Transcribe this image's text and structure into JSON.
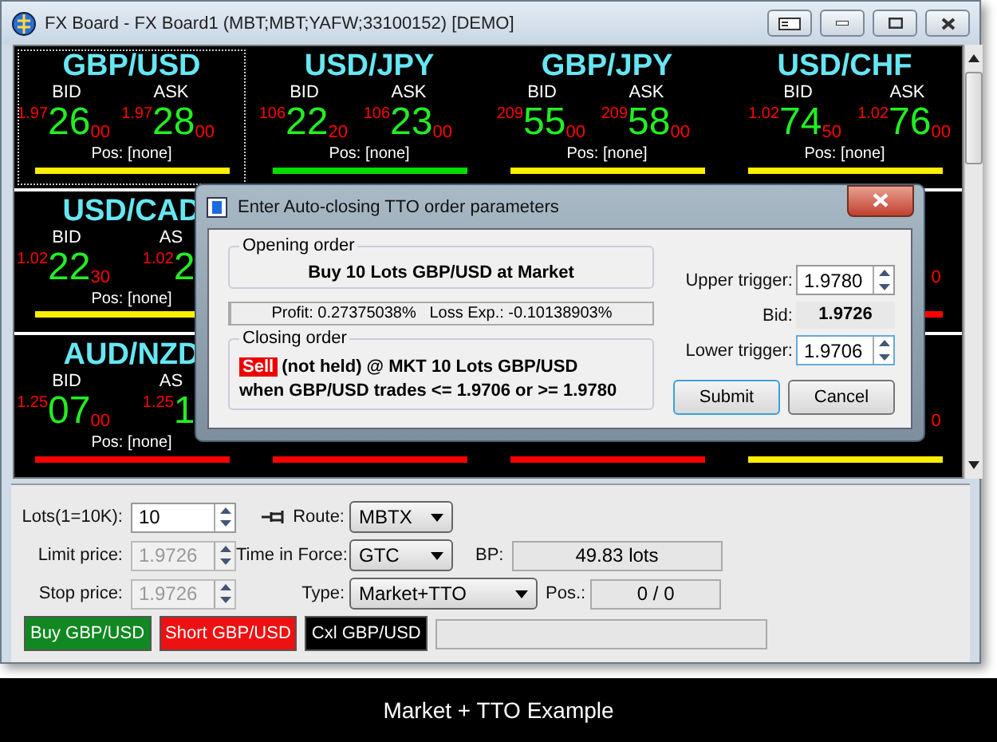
{
  "window": {
    "title": "FX Board - FX Board1 (MBT;MBT;YAFW;33100152) [DEMO]"
  },
  "board": {
    "rows": [
      {
        "tiles": [
          {
            "pair": "GBP/USD",
            "selected": true,
            "bid": {
              "label": "BID",
              "prefix": "1.97",
              "big": "26",
              "small": "00"
            },
            "ask": {
              "label": "ASK",
              "prefix": "1.97",
              "big": "28",
              "small": "00"
            },
            "pos": "Pos: [none]",
            "color": "#ffee00"
          },
          {
            "pair": "USD/JPY",
            "selected": false,
            "bid": {
              "label": "BID",
              "prefix": "106",
              "big": "22",
              "small": "20"
            },
            "ask": {
              "label": "ASK",
              "prefix": "106",
              "big": "23",
              "small": "00"
            },
            "pos": "Pos: [none]",
            "color": "#00dd00"
          },
          {
            "pair": "GBP/JPY",
            "selected": false,
            "bid": {
              "label": "BID",
              "prefix": "209",
              "big": "55",
              "small": "00"
            },
            "ask": {
              "label": "ASK",
              "prefix": "209",
              "big": "58",
              "small": "00"
            },
            "pos": "Pos: [none]",
            "color": "#ffee00"
          },
          {
            "pair": "USD/CHF",
            "selected": false,
            "bid": {
              "label": "BID",
              "prefix": "1.02",
              "big": "74",
              "small": "50"
            },
            "ask": {
              "label": "ASK",
              "prefix": "1.02",
              "big": "76",
              "small": "00"
            },
            "pos": "Pos: [none]",
            "color": "#ffee00"
          }
        ]
      },
      {
        "tiles": [
          {
            "pair": "USD/CAD",
            "selected": false,
            "bid": {
              "label": "BID",
              "prefix": "1.02",
              "big": "22",
              "small": "30"
            },
            "ask": {
              "label": "AS",
              "prefix": "1.02",
              "big": "2"
            },
            "pos": "Pos: [none]",
            "color": "#ffee00"
          },
          {
            "selected": false,
            "ask": {
              "small": "0"
            },
            "color": "#ff0000"
          }
        ]
      },
      {
        "tiles": [
          {
            "pair": "AUD/NZD",
            "selected": false,
            "bid": {
              "label": "BID",
              "prefix": "1.25",
              "big": "07",
              "small": "00"
            },
            "ask": {
              "label": "AS",
              "prefix": "1.25",
              "big": "1"
            },
            "pos": "Pos: [none]",
            "color": "#ff0000"
          },
          {
            "selected": false,
            "color": "#ff0000"
          },
          {
            "selected": false,
            "color": "#ff0000"
          },
          {
            "selected": false,
            "ask": {
              "small": "0"
            },
            "color": "#ffee00"
          }
        ]
      }
    ]
  },
  "order_panel": {
    "lots": {
      "label": "Lots(1=10K):",
      "value": "10",
      "disabled": false
    },
    "limit": {
      "label": "Limit price:",
      "value": "1.9726",
      "disabled": true
    },
    "stop": {
      "label": "Stop price:",
      "value": "1.9726",
      "disabled": true
    },
    "route": {
      "label": "Route:",
      "value": "MBTX"
    },
    "tif": {
      "label": "Time in Force:",
      "value": "GTC"
    },
    "type": {
      "label": "Type:",
      "value": "Market+TTO"
    },
    "bp": {
      "label": "BP:",
      "value": "49.83 lots"
    },
    "pos": {
      "label": "Pos.:",
      "value": "0 / 0"
    },
    "buttons": [
      {
        "label": "Buy GBP/USD",
        "kind": "buy"
      },
      {
        "label": "Short GBP/USD",
        "kind": "short"
      },
      {
        "label": "Cxl GBP/USD",
        "kind": "cancel"
      }
    ]
  },
  "dialog": {
    "title": "Enter Auto-closing TTO order parameters",
    "opening_order": {
      "legend": "Opening order",
      "text": "Buy 10 Lots GBP/USD at Market"
    },
    "stats": "Profit: 0.27375038%   Loss Exp.: -0.10138903%",
    "closing_order": {
      "legend": "Closing order",
      "action": "Sell",
      "line1": "(not held) @ MKT 10 Lots GBP/USD",
      "line2": "when GBP/USD trades <= 1.9706 or >= 1.9780"
    },
    "upper_trigger": {
      "label": "Upper trigger:",
      "value": "1.9780"
    },
    "bid": {
      "label": "Bid:",
      "value": "1.9726"
    },
    "lower_trigger": {
      "label": "Lower trigger:",
      "value": "1.9706"
    },
    "buttons": [
      "Submit",
      "Cancel"
    ]
  },
  "caption": "Market + TTO Example"
}
